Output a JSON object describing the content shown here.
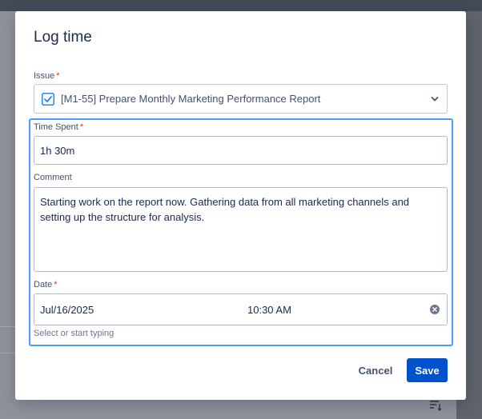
{
  "dialog": {
    "title": "Log time",
    "issue": {
      "label": "Issue",
      "required_mark": "*",
      "value": "[M1-55] Prepare Monthly Marketing Performance Report"
    },
    "time_spent": {
      "label": "Time Spent",
      "required_mark": "*",
      "value": "1h 30m"
    },
    "comment": {
      "label": "Comment",
      "value": "Starting work on the report now. Gathering data from all marketing channels and setting up the structure for analysis."
    },
    "date": {
      "label": "Date",
      "required_mark": "*",
      "date_value": "Jul/16/2025",
      "time_value": "10:30 AM",
      "helper": "Select or start typing"
    },
    "buttons": {
      "cancel": "Cancel",
      "save": "Save"
    }
  },
  "colors": {
    "primary": "#0052cc",
    "focus_ring": "#4c9aff",
    "required": "#de350b",
    "text": "#172b4d",
    "overlay": "#8f9298"
  },
  "icons": {
    "issue_type": "checkbox-task-icon",
    "dropdown": "chevron-down-icon",
    "clear": "clear-circle-icon",
    "background_sort": "sort-icon"
  }
}
